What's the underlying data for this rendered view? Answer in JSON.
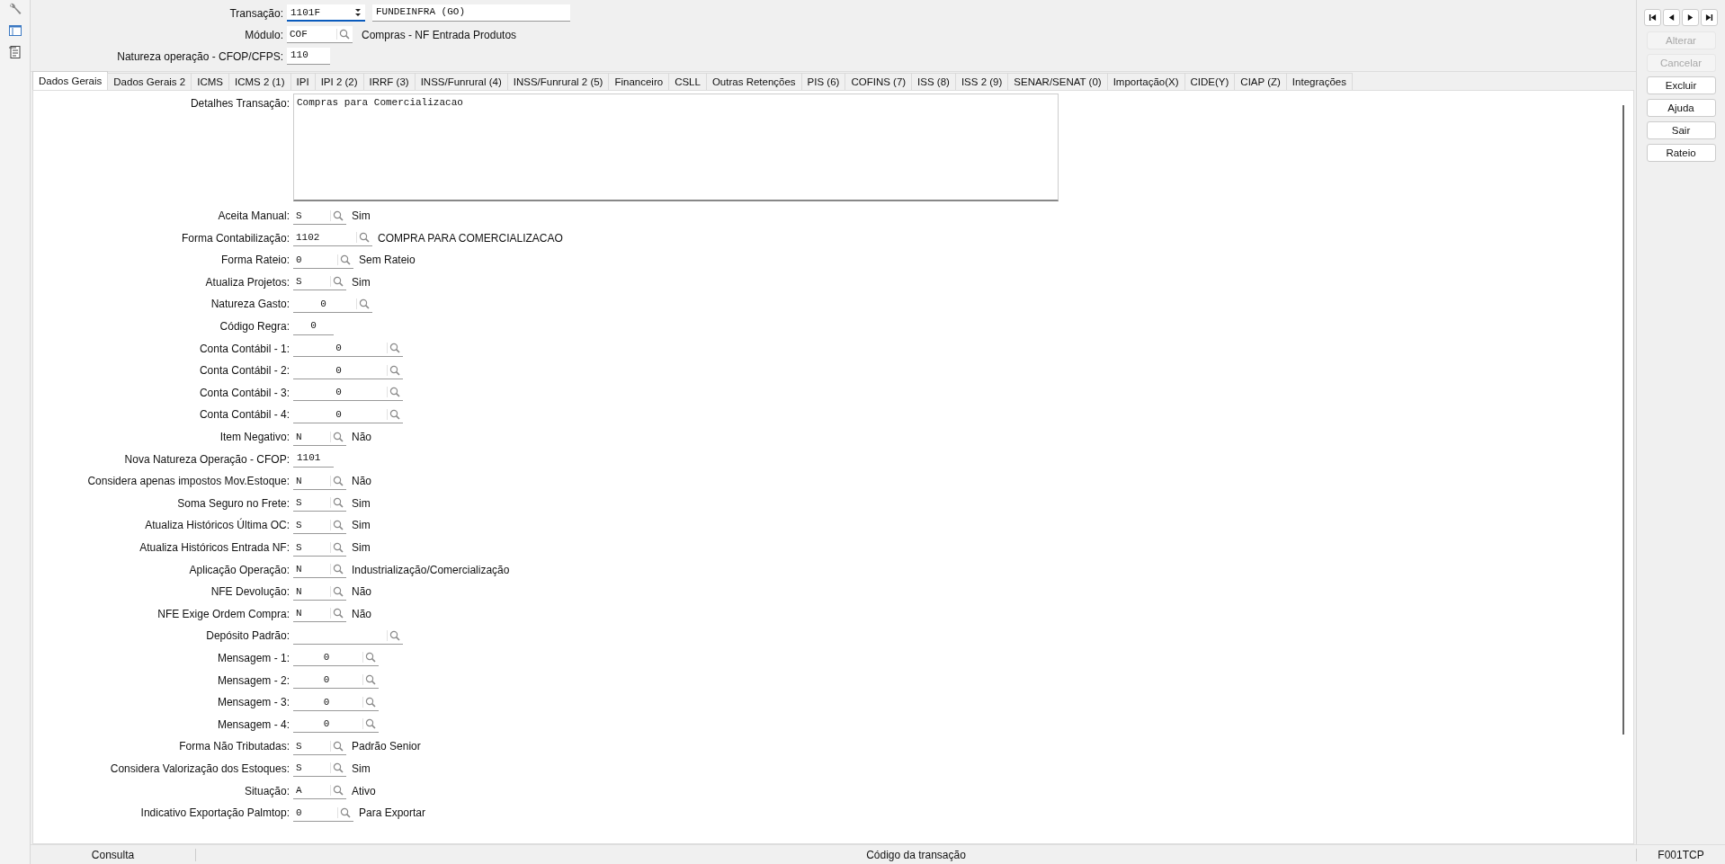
{
  "header": {
    "transacao": {
      "label": "Transação:",
      "code": "1101F",
      "focused": true,
      "name": "FUNDEINFRA (GO)"
    },
    "modulo": {
      "label": "Módulo:",
      "code": "COF",
      "description": "Compras - NF Entrada Produtos"
    },
    "natureza": {
      "label": "Natureza operação - CFOP/CFPS:",
      "code": "110"
    }
  },
  "tabs": [
    {
      "label": "Dados Gerais",
      "selected": true
    },
    {
      "label": "Dados Gerais 2",
      "selected": false
    },
    {
      "label": "ICMS",
      "selected": false
    },
    {
      "label": "ICMS 2 (1)",
      "selected": false
    },
    {
      "label": "IPI",
      "selected": false
    },
    {
      "label": "IPI 2 (2)",
      "selected": false
    },
    {
      "label": "IRRF (3)",
      "selected": false
    },
    {
      "label": "INSS/Funrural (4)",
      "selected": false
    },
    {
      "label": "INSS/Funrural 2 (5)",
      "selected": false
    },
    {
      "label": "Financeiro",
      "selected": false
    },
    {
      "label": "CSLL",
      "selected": false
    },
    {
      "label": "Outras Retenções",
      "selected": false
    },
    {
      "label": "PIS (6)",
      "selected": false
    },
    {
      "label": "COFINS (7)",
      "selected": false
    },
    {
      "label": "ISS (8)",
      "selected": false
    },
    {
      "label": "ISS 2 (9)",
      "selected": false
    },
    {
      "label": "SENAR/SENAT (0)",
      "selected": false
    },
    {
      "label": "Importação(X)",
      "selected": false
    },
    {
      "label": "CIDE(Y)",
      "selected": false
    },
    {
      "label": "CIAP (Z)",
      "selected": false
    },
    {
      "label": "Integrações",
      "selected": false
    }
  ],
  "details": {
    "label": "Detalhes Transação:",
    "value": "Compras para Comercializacao"
  },
  "fields": [
    {
      "label": "Aceita Manual:",
      "kind": "flag",
      "value": "S",
      "description": "Sim"
    },
    {
      "label": "Forma Contabilização:",
      "kind": "code",
      "value": "1102",
      "description": "COMPRA PARA COMERCIALIZACAO"
    },
    {
      "label": "Forma Rateio:",
      "kind": "option",
      "value": "0",
      "description": "Sem Rateio"
    },
    {
      "label": "Atualiza Projetos:",
      "kind": "flag",
      "value": "S",
      "description": "Sim"
    },
    {
      "label": "Natureza Gasto:",
      "kind": "number",
      "value": "0"
    },
    {
      "label": "Código Regra:",
      "kind": "short",
      "value": "0"
    },
    {
      "label": "Conta Contábil - 1:",
      "kind": "account",
      "value": "0"
    },
    {
      "label": "Conta Contábil - 2:",
      "kind": "account",
      "value": "0"
    },
    {
      "label": "Conta Contábil - 3:",
      "kind": "account",
      "value": "0"
    },
    {
      "label": "Conta Contábil - 4:",
      "kind": "account",
      "value": "0"
    },
    {
      "label": "Item Negativo:",
      "kind": "flag",
      "value": "N",
      "description": "Não"
    },
    {
      "label": "Nova Natureza Operação - CFOP:",
      "kind": "text",
      "value": "1101"
    },
    {
      "label": "Considera apenas impostos Mov.Estoque:",
      "kind": "flag",
      "value": "N",
      "description": "Não"
    },
    {
      "label": "Soma Seguro no Frete:",
      "kind": "flag",
      "value": "S",
      "description": "Sim"
    },
    {
      "label": "Atualiza Históricos Última OC:",
      "kind": "flag",
      "value": "S",
      "description": "Sim"
    },
    {
      "label": "Atualiza Históricos Entrada NF:",
      "kind": "flag",
      "value": "S",
      "description": "Sim"
    },
    {
      "label": "Aplicação Operação:",
      "kind": "flag",
      "value": "N",
      "description": "Industrialização/Comercialização"
    },
    {
      "label": "NFE Devolução:",
      "kind": "flag",
      "value": "N",
      "description": "Não"
    },
    {
      "label": "NFE Exige Ordem Compra:",
      "kind": "flag",
      "value": "N",
      "description": "Não"
    },
    {
      "label": "Depósito Padrão:",
      "kind": "deposit"
    },
    {
      "label": "Mensagem - 1:",
      "kind": "message",
      "value": "0"
    },
    {
      "label": "Mensagem - 2:",
      "kind": "message",
      "value": "0"
    },
    {
      "label": "Mensagem - 3:",
      "kind": "message",
      "value": "0"
    },
    {
      "label": "Mensagem - 4:",
      "kind": "message",
      "value": "0"
    },
    {
      "label": "Forma Não Tributadas:",
      "kind": "flag",
      "value": "S",
      "description": "Padrão Senior"
    },
    {
      "label": "Considera Valorização dos Estoques:",
      "kind": "flag",
      "value": "S",
      "description": "Sim"
    },
    {
      "label": "Situação:",
      "kind": "flag",
      "value": "A",
      "description": "Ativo"
    },
    {
      "label": "Indicativo Exportação Palmtop:",
      "kind": "option",
      "value": "0",
      "description": "Para Exportar"
    }
  ],
  "actions": [
    {
      "label": "Alterar",
      "disabled": true
    },
    {
      "label": "Cancelar",
      "disabled": true
    },
    {
      "label": "Excluir",
      "disabled": false
    },
    {
      "label": "Ajuda",
      "disabled": false
    },
    {
      "label": "Sair",
      "disabled": false
    },
    {
      "label": "Rateio",
      "disabled": false
    }
  ],
  "status_bar": {
    "mode": "Consulta",
    "hint": "Código da transação",
    "screen": "F001TCP"
  }
}
